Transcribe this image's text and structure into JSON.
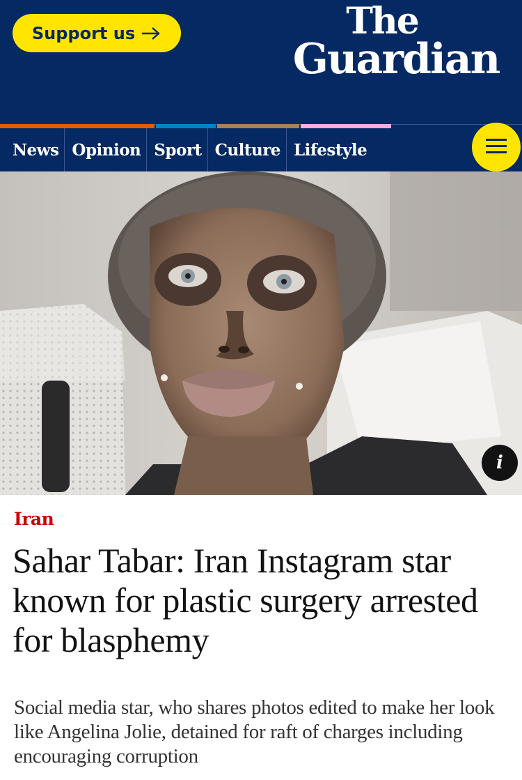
{
  "header": {
    "support_label": "Support us",
    "logo_line1": "The",
    "logo_line2": "Guardian",
    "background": "#052962",
    "accent": "#ffe500"
  },
  "nav": {
    "items": [
      {
        "label": "News",
        "color": "#c70000"
      },
      {
        "label": "Opinion",
        "color": "#e05e00"
      },
      {
        "label": "Sport",
        "color": "#0084c6"
      },
      {
        "label": "Culture",
        "color": "#a1845c"
      },
      {
        "label": "Lifestyle",
        "color": "#bb3b80"
      }
    ],
    "menu_icon": "hamburger-icon"
  },
  "photo": {
    "info_label": "i"
  },
  "article": {
    "kicker": "Iran",
    "headline": "Sahar Tabar: Iran Instagram star known for plastic surgery arrested for blasphemy",
    "standfirst": "Social media star, who shares photos edited to make her look like Angelina Jolie, detained for raft of charges including encouraging corruption",
    "kicker_color": "#c70000"
  }
}
